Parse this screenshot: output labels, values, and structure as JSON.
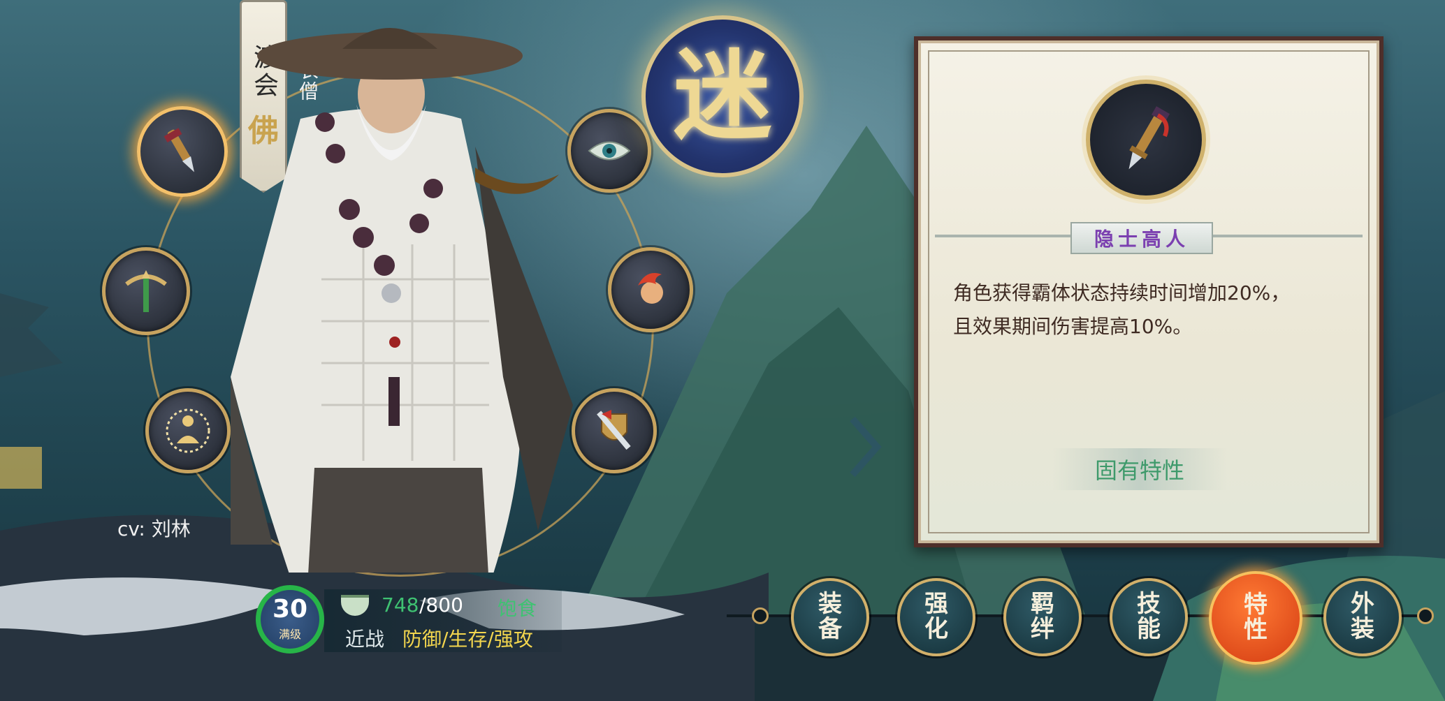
{
  "character": {
    "title_char": "佛",
    "name": "渡会",
    "subtitle": "白衣僧",
    "cv_label": "cv: 刘林"
  },
  "emblem": {
    "label": "迷"
  },
  "status": {
    "level": "30",
    "level_caption": "满级",
    "stamina_current": "748",
    "stamina_max": "/800",
    "stamina_state": "饱食",
    "combat_type": "近战",
    "roles": "防御/生存/强攻"
  },
  "trait_panel": {
    "trait_name": "隐士高人",
    "description_line1": "角色获得霸体状态持续时间增加20%，",
    "description_line2": "且效果期间伤害提高10%。",
    "trait_category": "固有特性"
  },
  "tabs": [
    {
      "label": "装备"
    },
    {
      "label": "强化"
    },
    {
      "label": "羁绊"
    },
    {
      "label": "技能"
    },
    {
      "label": "特性"
    },
    {
      "label": "外装"
    }
  ],
  "colors": {
    "accent_gold": "#c7a35f",
    "selected_tab": "#e64d18",
    "trait_name": "#7b3fb0",
    "category_text": "#3e9a6b",
    "level_ring": "#27b548"
  }
}
